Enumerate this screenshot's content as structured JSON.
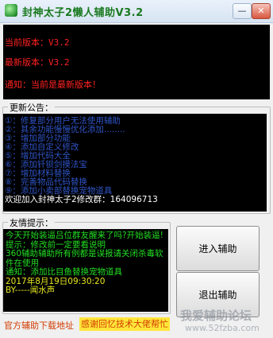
{
  "window": {
    "title": "封神太子2懒人辅助V3.2",
    "minimize_glyph": "—",
    "close_glyph": "✕"
  },
  "version_panel": {
    "current": "当前版本：V3.2",
    "latest": "最新版本：V3.2",
    "notice": "通知：当前是最新版本！"
  },
  "announcement": {
    "legend": "更新公告：",
    "lines": [
      "①：修复部分用户无法使用辅助",
      "②：其余功能慢慢优化添加........",
      "③：增加部分功能",
      "④：添加自定义修改",
      "⑤：增加代码大全",
      "⑥：添加钎钡剑摸法宝",
      "⑦：增加材料替换",
      "⑧：完善物品代码替换",
      "⑨：添加小卖部替换宠物道具",
      "欢迎加入封神太子2修改群：164096713"
    ]
  },
  "tips": {
    "legend": "友情提示：",
    "line1": "今天开始装逼吕位群友醒来了吗?开始装逼!",
    "line2": "提示：修改前一定要看说明",
    "line3": "360辅助辅助所有例都是误报请关闭杀毒软件在使用",
    "line4": "通知：添加比目鱼替换宠物道具",
    "date": "2017年8月19日09:30:20",
    "author": "BY-----闻水声"
  },
  "buttons": {
    "enter": "进入辅助",
    "exit": "退出辅助"
  },
  "footer": {
    "download": "官方辅助下载地址",
    "thanks": "感谢回忆技术大佬帮忙"
  },
  "watermark": {
    "text": "我爱辅助论坛",
    "url": "www.52fzba.com"
  }
}
